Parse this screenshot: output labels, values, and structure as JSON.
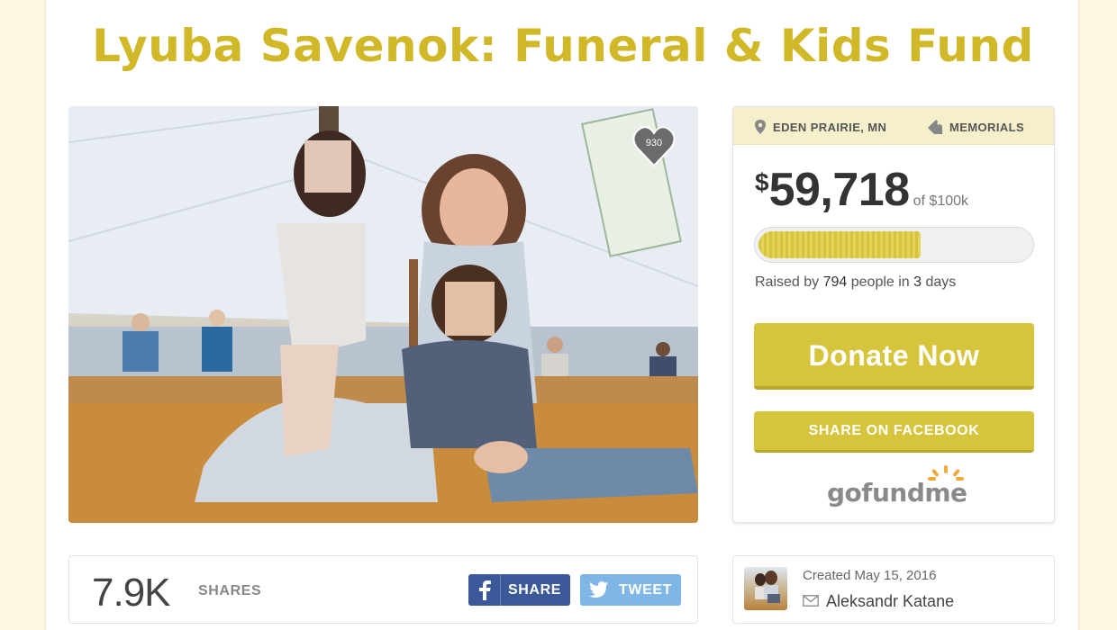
{
  "campaign": {
    "title": "Lyuba Savenok: Funeral & Kids Fund",
    "heart_count": "930",
    "location": "EDEN PRAIRIE, MN",
    "category": "MEMORIALS",
    "currency_symbol": "$",
    "raised_amount": "59,718",
    "goal_text": "of $100k",
    "progress_fraction": 0.597,
    "stats": {
      "prefix": "Raised by ",
      "people": "794",
      "middle": " people in ",
      "days": "3",
      "suffix": " days"
    },
    "donate_label": "Donate Now",
    "share_facebook_label": "SHARE ON FACEBOOK",
    "logo_text": "gofundme"
  },
  "shares": {
    "count": "7.9K",
    "label": "SHARES",
    "fb_label": "SHARE",
    "tw_label": "TWEET"
  },
  "organizer": {
    "created": "Created May 15, 2016",
    "name": "Aleksandr Katane"
  },
  "colors": {
    "accent": "#d6c43c",
    "title": "#d1b829",
    "facebook": "#3b5998",
    "twitter": "#7fb6e6",
    "page_bg": "#fdf6e3"
  },
  "icons": [
    "heart-icon",
    "location-pin-icon",
    "tag-icon",
    "facebook-icon",
    "twitter-icon",
    "envelope-icon",
    "sunburst-icon"
  ]
}
